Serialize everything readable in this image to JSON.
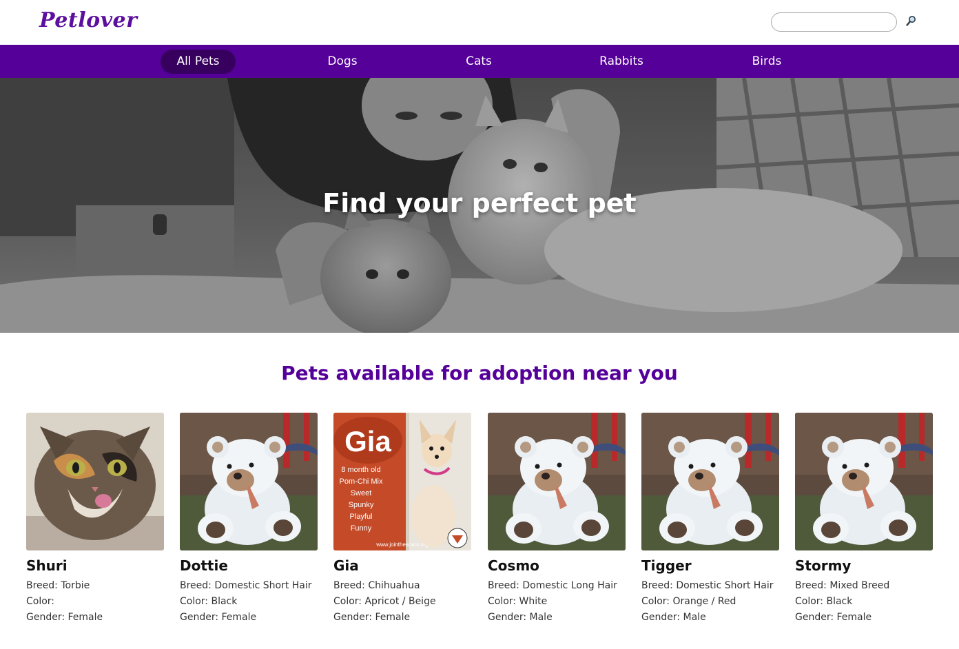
{
  "header": {
    "logo": "Petlover",
    "search": {
      "value": "",
      "placeholder": ""
    }
  },
  "nav": {
    "items": [
      {
        "label": "All Pets",
        "active": true
      },
      {
        "label": "Dogs",
        "active": false
      },
      {
        "label": "Cats",
        "active": false
      },
      {
        "label": "Rabbits",
        "active": false
      },
      {
        "label": "Birds",
        "active": false
      }
    ]
  },
  "hero": {
    "title": "Find your perfect pet"
  },
  "section": {
    "title": "Pets available for adoption near you"
  },
  "labels": {
    "breed": "Breed:",
    "color": "Color:",
    "gender": "Gender:"
  },
  "pets": [
    {
      "name": "Shuri",
      "breed": "Torbie",
      "color": "",
      "gender": "Female",
      "photo": "tortie-cat"
    },
    {
      "name": "Dottie",
      "breed": "Domestic Short Hair",
      "color": "Black",
      "gender": "Female",
      "photo": "teddy-bear-placeholder"
    },
    {
      "name": "Gia",
      "breed": "Chihuahua",
      "color": "Apricot / Beige",
      "gender": "Female",
      "photo": "gia-flyer",
      "flyer": {
        "title": "Gia",
        "lines": [
          "8 month old",
          "Pom-Chi Mix",
          "Sweet",
          "Spunky",
          "Playful",
          "Funny"
        ],
        "url": "www.jointhescars.org"
      }
    },
    {
      "name": "Cosmo",
      "breed": "Domestic Long Hair",
      "color": "White",
      "gender": "Male",
      "photo": "teddy-bear-placeholder"
    },
    {
      "name": "Tigger",
      "breed": "Domestic Short Hair",
      "color": "Orange / Red",
      "gender": "Male",
      "photo": "teddy-bear-placeholder"
    },
    {
      "name": "Stormy",
      "breed": "Mixed Breed",
      "color": "Black",
      "gender": "Female",
      "photo": "teddy-bear-placeholder"
    }
  ],
  "colors": {
    "brand": "#550099",
    "nav_active": "#37005f"
  }
}
